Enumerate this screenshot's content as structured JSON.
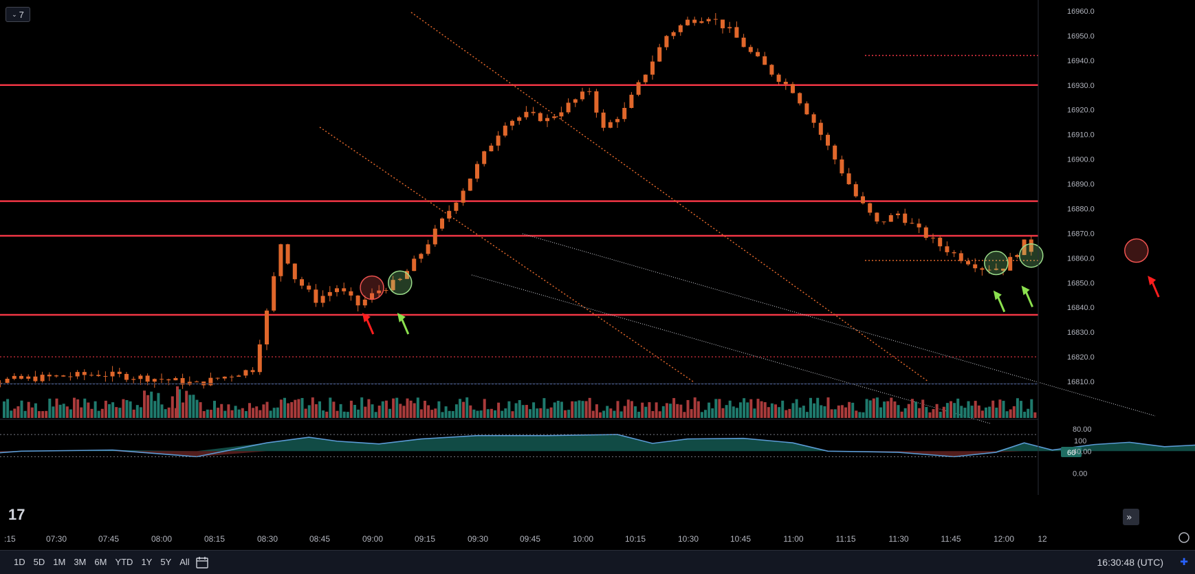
{
  "toolbar": {
    "interval_label": "7"
  },
  "chart_data": {
    "type": "candlestick",
    "price_axis": {
      "ticks": [
        "16960.0",
        "16950.0",
        "16940.0",
        "16930.0",
        "16920.0",
        "16910.0",
        "16900.0",
        "16890.0",
        "16880.0",
        "16870.0",
        "16860.0",
        "16850.0",
        "16840.0",
        "16830.0",
        "16820.0",
        "16810.0"
      ],
      "range": [
        16809,
        16961
      ]
    },
    "time_axis": {
      "ticks": [
        ":15",
        "07:30",
        "07:45",
        "08:00",
        "08:15",
        "08:30",
        "08:45",
        "09:00",
        "09:15",
        "09:30",
        "09:45",
        "10:00",
        "10:15",
        "10:30",
        "10:45",
        "11:00",
        "11:15",
        "11:30",
        "11:45",
        "12:00",
        "12"
      ]
    },
    "horizontal_levels": [
      16930,
      16883,
      16869,
      16837
    ],
    "dotted_levels": [
      16820,
      16859,
      16942
    ],
    "baseline_level": 16809,
    "price_path": [
      [
        "07:12",
        16813
      ],
      [
        "07:20",
        16810
      ],
      [
        "07:30",
        16812
      ],
      [
        "07:36",
        16813
      ],
      [
        "07:45",
        16811
      ],
      [
        "07:50",
        16809
      ],
      [
        "07:58",
        16815
      ],
      [
        "08:00",
        16838
      ],
      [
        "08:02",
        16866
      ],
      [
        "08:04",
        16852
      ],
      [
        "08:07",
        16843
      ],
      [
        "08:10",
        16848
      ],
      [
        "08:13",
        16841
      ],
      [
        "08:16",
        16847
      ],
      [
        "08:19",
        16851
      ],
      [
        "08:22",
        16862
      ],
      [
        "08:25",
        16875
      ],
      [
        "08:28",
        16888
      ],
      [
        "08:31",
        16902
      ],
      [
        "08:34",
        16915
      ],
      [
        "08:37",
        16918
      ],
      [
        "08:40",
        16916
      ],
      [
        "08:43",
        16922
      ],
      [
        "08:46",
        16928
      ],
      [
        "08:48",
        16912
      ],
      [
        "08:51",
        16920
      ],
      [
        "08:54",
        16935
      ],
      [
        "08:57",
        16950
      ],
      [
        "09:00",
        16956
      ],
      [
        "09:03",
        16958
      ],
      [
        "09:06",
        16952
      ],
      [
        "09:09",
        16943
      ],
      [
        "09:12",
        16935
      ],
      [
        "09:15",
        16928
      ],
      [
        "09:18",
        16915
      ],
      [
        "09:21",
        16900
      ],
      [
        "09:24",
        16885
      ],
      [
        "09:27",
        16874
      ],
      [
        "09:30",
        16878
      ],
      [
        "09:33",
        16871
      ],
      [
        "09:36",
        16865
      ],
      [
        "09:39",
        16860
      ],
      [
        "09:42",
        16856
      ],
      [
        "09:45",
        16856
      ],
      [
        "09:48",
        16866
      ],
      [
        "09:51",
        16858
      ],
      [
        "09:54",
        16850
      ],
      [
        "09:57",
        16853
      ],
      [
        "10:00",
        16861
      ],
      [
        "10:03",
        16863
      ],
      [
        "10:06",
        16855
      ],
      [
        "10:09",
        16848
      ],
      [
        "10:12",
        16851
      ],
      [
        "10:15",
        16847
      ],
      [
        "10:18",
        16852
      ],
      [
        "10:21",
        16848
      ],
      [
        "10:24",
        16840
      ],
      [
        "10:27",
        16820
      ],
      [
        "10:30",
        16815
      ],
      [
        "10:33",
        16817
      ],
      [
        "10:36",
        16820
      ],
      [
        "10:39",
        16823
      ],
      [
        "10:42",
        16826
      ],
      [
        "10:45",
        16828
      ],
      [
        "10:48",
        16831
      ],
      [
        "10:51",
        16836
      ],
      [
        "10:54",
        16834
      ],
      [
        "10:57",
        16832
      ],
      [
        "11:00",
        16826
      ],
      [
        "11:03",
        16820
      ],
      [
        "11:06",
        16815
      ],
      [
        "11:09",
        16812
      ],
      [
        "11:12",
        16810
      ]
    ],
    "volume_axis": {
      "ticks": [
        "100"
      ],
      "badge": "60"
    },
    "oscillator_axis": {
      "ticks": [
        "80.00",
        "40.00",
        "0.00"
      ]
    },
    "oscillator_path": [
      [
        "07:12",
        28
      ],
      [
        "07:25",
        40
      ],
      [
        "07:38",
        42
      ],
      [
        "07:50",
        30
      ],
      [
        "08:00",
        55
      ],
      [
        "08:06",
        65
      ],
      [
        "08:10",
        58
      ],
      [
        "08:16",
        53
      ],
      [
        "08:22",
        62
      ],
      [
        "08:30",
        68
      ],
      [
        "08:40",
        68
      ],
      [
        "08:50",
        70
      ],
      [
        "08:55",
        54
      ],
      [
        "09:00",
        62
      ],
      [
        "09:08",
        63
      ],
      [
        "09:15",
        55
      ],
      [
        "09:20",
        40
      ],
      [
        "09:30",
        38
      ],
      [
        "09:38",
        30
      ],
      [
        "09:44",
        38
      ],
      [
        "09:48",
        55
      ],
      [
        "09:52",
        42
      ],
      [
        "09:58",
        52
      ],
      [
        "10:03",
        56
      ],
      [
        "10:08",
        48
      ],
      [
        "10:14",
        52
      ],
      [
        "10:20",
        40
      ],
      [
        "10:26",
        28
      ],
      [
        "10:30",
        30
      ],
      [
        "10:36",
        36
      ],
      [
        "10:42",
        48
      ],
      [
        "10:48",
        58
      ],
      [
        "10:53",
        54
      ],
      [
        "10:58",
        48
      ],
      [
        "11:05",
        38
      ],
      [
        "11:12",
        33
      ],
      [
        "11:20",
        22
      ],
      [
        "11:28",
        18
      ],
      [
        "11:35",
        40
      ],
      [
        "11:42",
        45
      ],
      [
        "11:50",
        43
      ],
      [
        "11:56",
        52
      ],
      [
        "12:03",
        44
      ],
      [
        "12:10",
        52
      ]
    ],
    "colors": {
      "up": "#26a69a",
      "down": "#ef5350",
      "candle": "#e0672b",
      "level": "#f23645",
      "channel": "#d1d4dc",
      "osc_line": "#5b9bd5"
    },
    "annotations": {
      "green_circles": [
        [
          "08:19",
          16850
        ],
        [
          "09:44",
          16858
        ],
        [
          "09:49",
          16861
        ],
        [
          "10:39",
          16820
        ],
        [
          "10:47",
          16827
        ]
      ],
      "red_circles": [
        [
          "08:15",
          16848
        ],
        [
          "10:04",
          16863
        ],
        [
          "10:35",
          16818
        ]
      ],
      "green_arrows": [
        [
          "08:19",
          16837
        ],
        [
          "09:44",
          16846
        ],
        [
          "09:48",
          16848
        ],
        [
          "10:38",
          16812
        ],
        [
          "10:47",
          16820
        ]
      ],
      "red_arrows": [
        [
          "08:14",
          16837
        ],
        [
          "10:06",
          16852
        ],
        [
          "10:35",
          16812
        ]
      ]
    }
  },
  "bottom_bar": {
    "ranges": [
      "1D",
      "5D",
      "1M",
      "3M",
      "6M",
      "YTD",
      "1Y",
      "5Y",
      "All"
    ],
    "clock": "16:30:48 (UTC)"
  }
}
